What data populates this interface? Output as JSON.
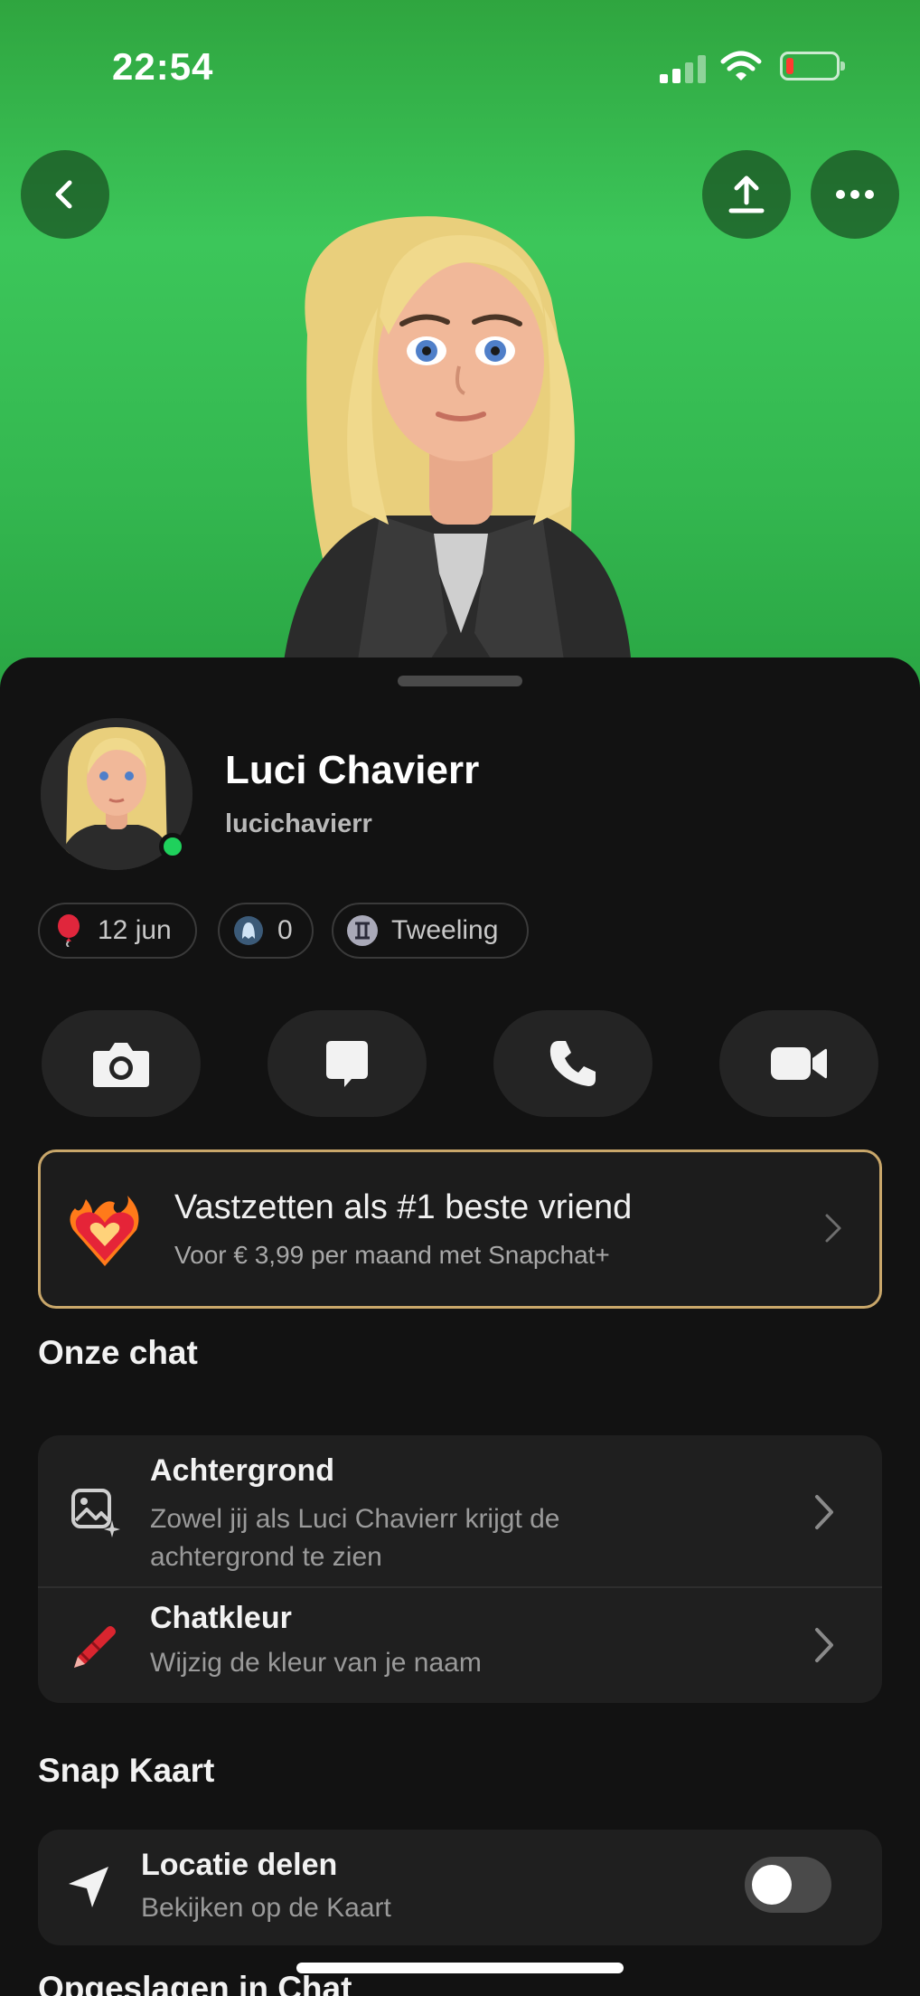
{
  "status_bar": {
    "time": "22:54"
  },
  "profile": {
    "display_name": "Luci Chavierr",
    "username": "lucichavierr"
  },
  "chips": [
    {
      "icon": "balloon-icon",
      "label": "12 jun"
    },
    {
      "icon": "snap-score-ghost-icon",
      "label": "0"
    },
    {
      "icon": "gemini-zodiac-icon",
      "label": "Tweeling"
    }
  ],
  "actions": [
    "camera-icon",
    "chat-icon",
    "phone-icon",
    "video-icon"
  ],
  "promo": {
    "title": "Vastzetten als #1 beste vriend",
    "subtitle": "Voor € 3,99 per maand met Snapchat+"
  },
  "our_chat": {
    "section_title": "Onze chat",
    "rows": [
      {
        "title": "Achtergrond",
        "subtitle_line1": "Zowel jij als Luci Chavierr krijgt de",
        "subtitle_line2": "achtergrond te zien"
      },
      {
        "title": "Chatkleur",
        "subtitle_line1": "Wijzig de kleur van je naam"
      }
    ]
  },
  "snap_map": {
    "section_title": "Snap Kaart",
    "location_title": "Locatie delen",
    "location_subtitle": "Bekijken op de Kaart",
    "location_enabled": false
  },
  "next_section": {
    "title": "Opgeslagen in Chat"
  },
  "colors": {
    "hero_green": "#3cc65a",
    "sheet_bg": "#121212",
    "card_bg": "#1f1f1f",
    "promo_border": "#c9a76a",
    "online": "#1fd15c"
  }
}
